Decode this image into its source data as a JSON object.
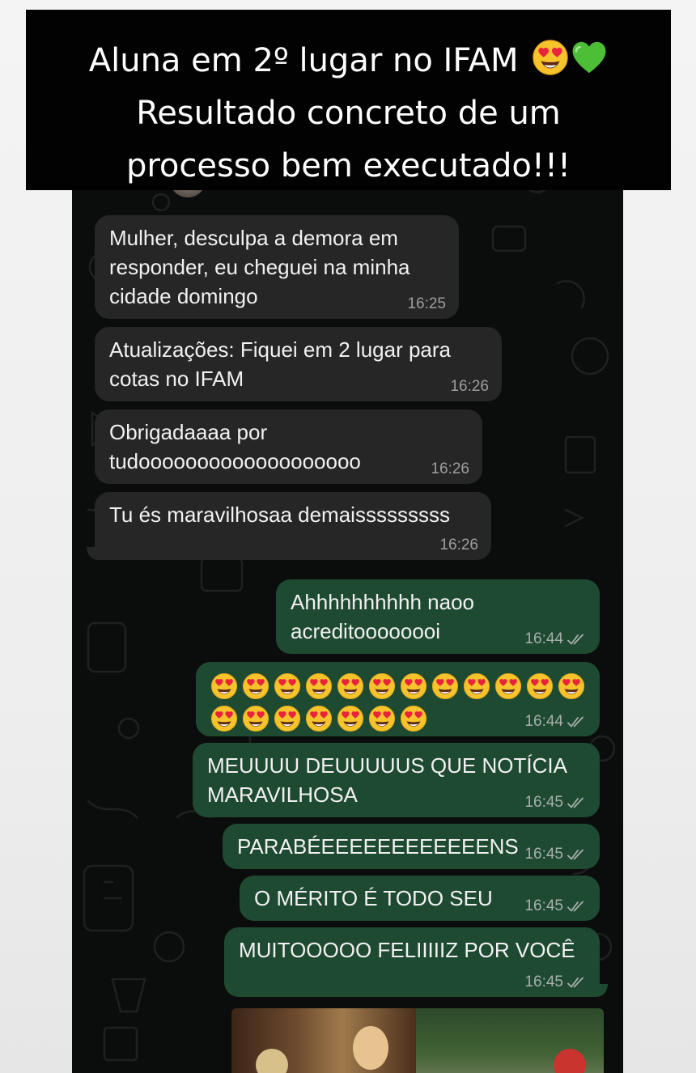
{
  "overlay": {
    "headline_line1": "Aluna em 2º lugar no IFAM",
    "headline_line2": "Resultado concreto de um",
    "headline_line3": "processo bem executado!!!",
    "headline_emojis": [
      "smiling-face-with-heart-eyes-icon",
      "green-heart-icon"
    ]
  },
  "chat": {
    "incoming": [
      {
        "text": "Mulher, desculpa a demora em\nresponder, eu cheguei na minha\ncidade domingo",
        "time": "16:25"
      },
      {
        "text": "Atualizações: Fiquei em 2 lugar para\ncotas no IFAM",
        "time": "16:26"
      },
      {
        "text": "Obrigadaaaa por\ntudooooooooooooooooooo",
        "time": "16:26"
      },
      {
        "text": "Tu és maravilhosaa demaisssssssss",
        "time": "16:26"
      }
    ],
    "outgoing": [
      {
        "text": "Ahhhhhhhhhh naoo\nacreditoooooooi",
        "time": "16:44"
      },
      {
        "emoji_row1_count": 12,
        "emoji_row2_count": 7,
        "emoji": "smiling-face-with-heart-eyes-icon",
        "time": "16:44"
      },
      {
        "text": "MEUUUU DEUUUUUS QUE NOTÍCIA\nMARAVILHOSA",
        "time": "16:45"
      },
      {
        "text": "PARABÉEEEEEEEEEEEENS",
        "time": "16:45"
      },
      {
        "text": "O MÉRITO É TODO SEU",
        "time": "16:45"
      },
      {
        "text": "MUITOOOOO FELIIIIIZ POR VOCÊ",
        "time": "16:45"
      }
    ],
    "read_receipt_icon": "double-check-icon"
  },
  "colors": {
    "incoming_bubble": "#262626",
    "outgoing_bubble": "#1f4a32",
    "chat_background": "#0b0d0c",
    "overlay_background": "#020202"
  }
}
